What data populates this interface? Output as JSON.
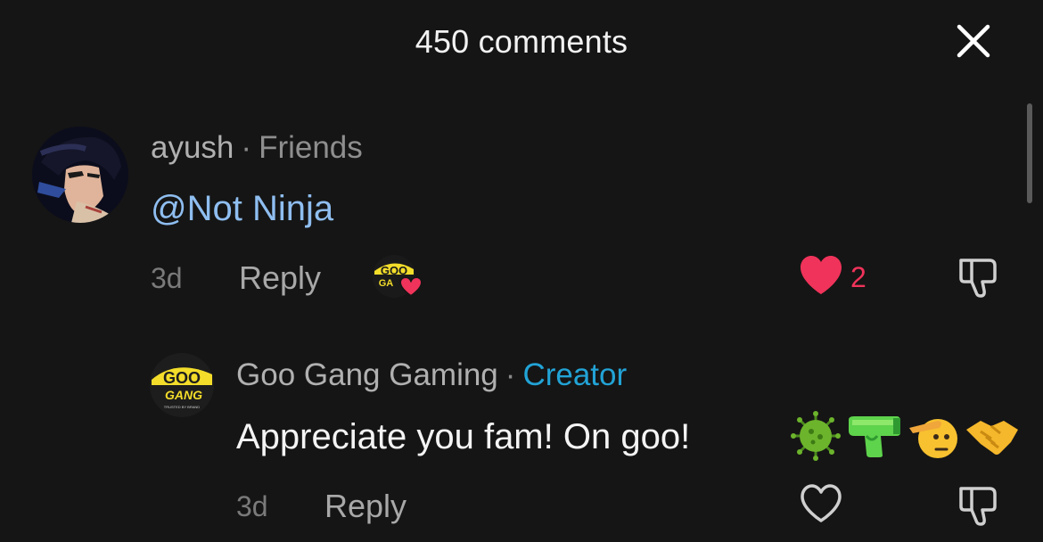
{
  "header": {
    "title": "450 comments"
  },
  "comments": [
    {
      "username": "ayush",
      "separator": "·",
      "tag": "Friends",
      "text": "@Not Ninja",
      "age": "3d",
      "reply_label": "Reply",
      "likes": "2",
      "liked": true
    },
    {
      "username": "Goo Gang Gaming",
      "separator": "·",
      "tag": "Creator",
      "text": "Appreciate you fam! On goo!",
      "emojis": [
        "microbe-emoji",
        "water-pistol-emoji",
        "saluting-face-emoji",
        "handshake-emoji"
      ],
      "age": "3d",
      "reply_label": "Reply",
      "liked": false
    }
  ],
  "avatar_text": {
    "logo_line1": "GOO",
    "logo_line2": "GANG",
    "logo_tagline": "TRUSTED BY BRAND"
  },
  "colors": {
    "background": "#151515",
    "like_red": "#f0335a",
    "creator_blue": "#22a3d6",
    "mention_blue": "#8fbef0",
    "logo_yellow": "#f3dd2a"
  }
}
